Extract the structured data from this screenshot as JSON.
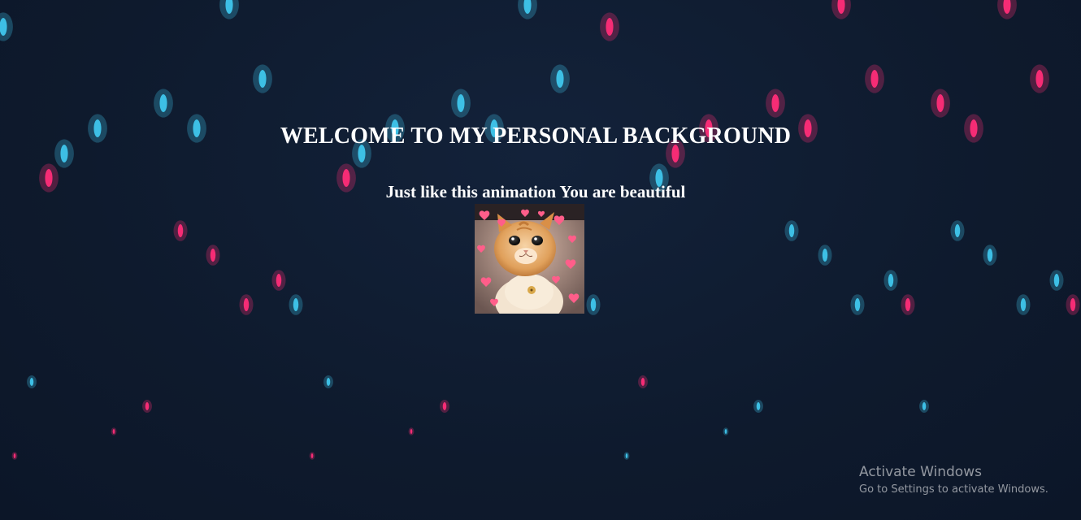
{
  "page": {
    "title": "WELCOME TO MY PERSONAL BACKGROUND",
    "subtitle": "Just like this animation You are beautiful"
  },
  "image": {
    "subject": "cat-with-hearts-photo"
  },
  "watermark": {
    "title": "Activate Windows",
    "subtitle": "Go to Settings to activate Windows."
  },
  "colors": {
    "background": "#0f1a2e",
    "blue_dot": "#3fc6ec",
    "pink_dot": "#ff2d78",
    "text": "#ffffff"
  }
}
